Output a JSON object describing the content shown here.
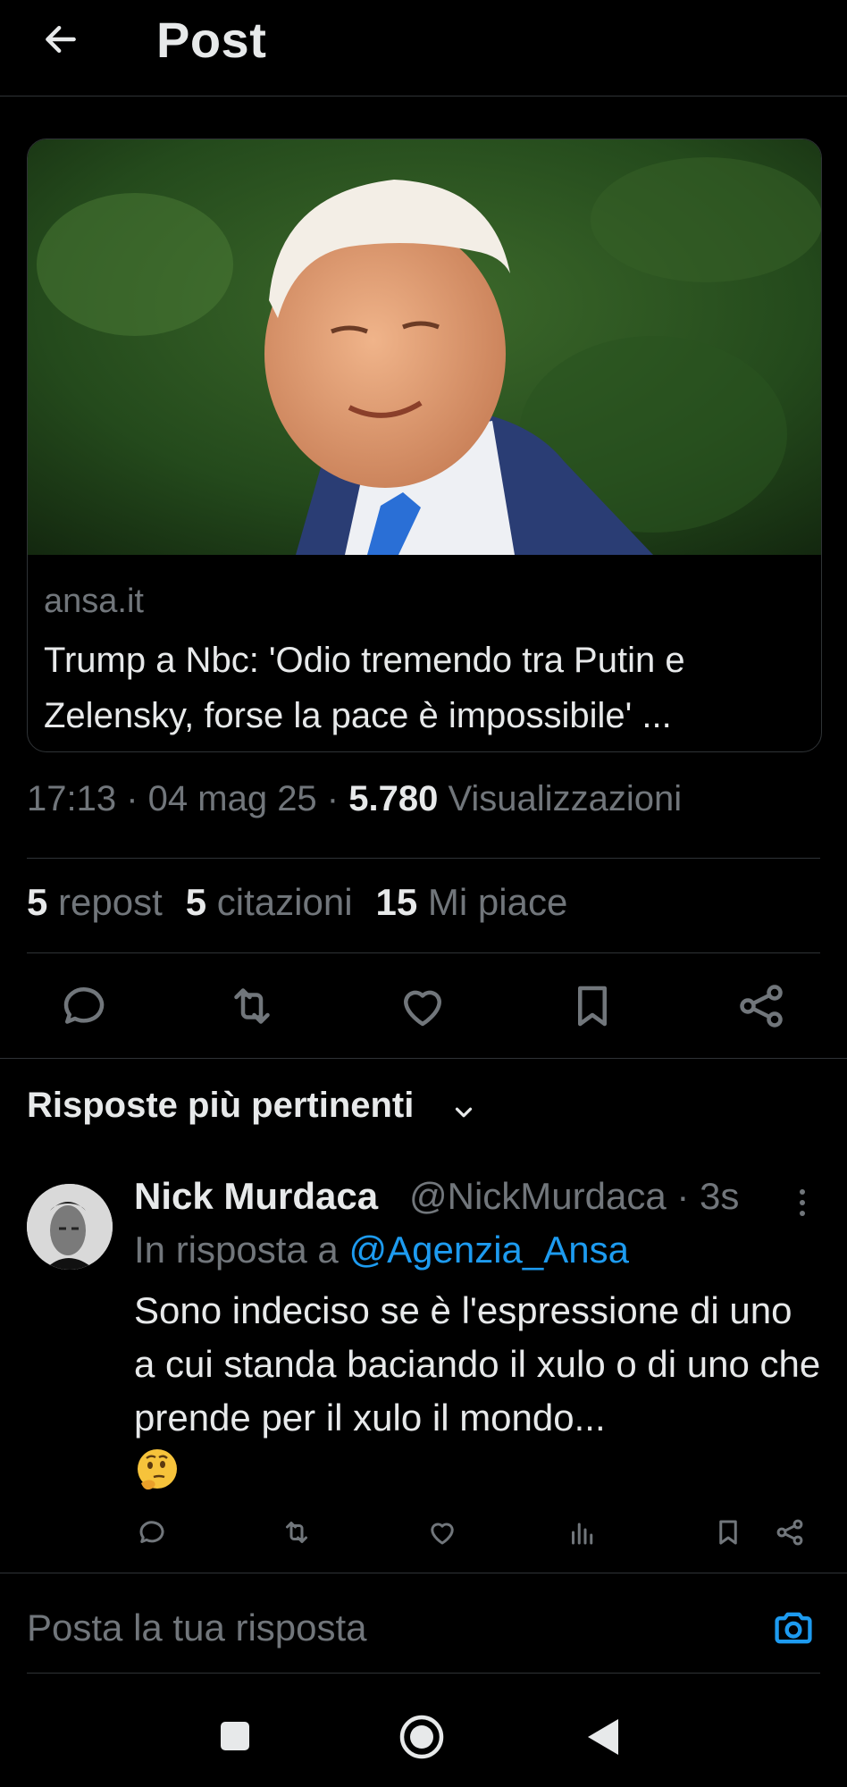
{
  "header": {
    "title": "Post",
    "back_icon": "arrow-left-icon"
  },
  "card": {
    "domain": "ansa.it",
    "headline": "Trump a Nbc: 'Odio tremendo tra Putin e Zelensky, forse la pace è impossibile' ..."
  },
  "meta": {
    "time": "17:13",
    "sep1": " · ",
    "date": "04 mag 25",
    "sep2": " · ",
    "views_count": "5.780",
    "views_label": " Visualizzazioni"
  },
  "stats": {
    "reposts_count": "5",
    "reposts_label": " repost",
    "quotes_count": "5",
    "quotes_label": " citazioni",
    "likes_count": "15",
    "likes_label": " Mi piace"
  },
  "actions": [
    "comment-icon",
    "repost-icon",
    "like-icon",
    "bookmark-icon",
    "share-icon"
  ],
  "replies": {
    "sort_label": "Risposte più pertinenti",
    "items": [
      {
        "name": "Nick Murdaca",
        "handle": "@NickMurdaca · 3s",
        "in_reply_prefix": "In risposta a ",
        "in_reply_handle": "@Agenzia_Ansa",
        "text": "Sono indeciso se è l'espressione di uno a cui standa baciando il xulo o di uno che prende per il xulo il mondo...",
        "emoji": "thinking-face-emoji"
      }
    ]
  },
  "compose": {
    "placeholder": "Posta la tua risposta",
    "camera_icon": "camera-icon"
  },
  "colors": {
    "background": "#000000",
    "text": "#e7e9ea",
    "muted": "#71767b",
    "accent": "#1d9bf0",
    "divider": "#2f3336"
  }
}
